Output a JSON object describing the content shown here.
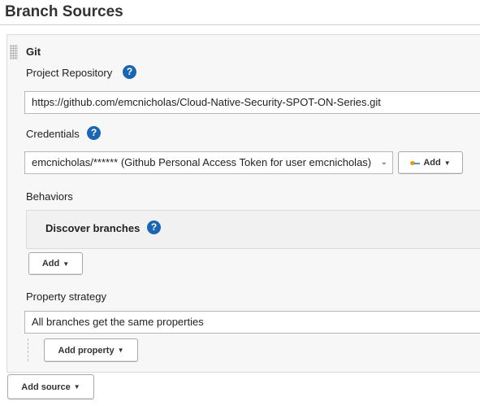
{
  "section": {
    "title": "Branch Sources"
  },
  "git": {
    "heading": "Git",
    "project_repository": {
      "label": "Project Repository",
      "help_glyph": "?",
      "value": "https://github.com/emcnicholas/Cloud-Native-Security-SPOT-ON-Series.git"
    },
    "credentials": {
      "label": "Credentials",
      "help_glyph": "?",
      "selected": "emcnicholas/****** (Github Personal Access Token for user emcnicholas)",
      "add_label": "Add",
      "add_icon": "key-icon"
    },
    "behaviors": {
      "label": "Behaviors",
      "discover_branches": {
        "label": "Discover branches",
        "help_glyph": "?"
      },
      "add_label": "Add"
    },
    "property_strategy": {
      "label": "Property strategy",
      "selected": "All branches get the same properties",
      "add_property_label": "Add property"
    }
  },
  "footer": {
    "add_source_label": "Add source"
  },
  "colors": {
    "help_icon": "#1a66b3",
    "panel_bg": "#f7f7f7"
  }
}
